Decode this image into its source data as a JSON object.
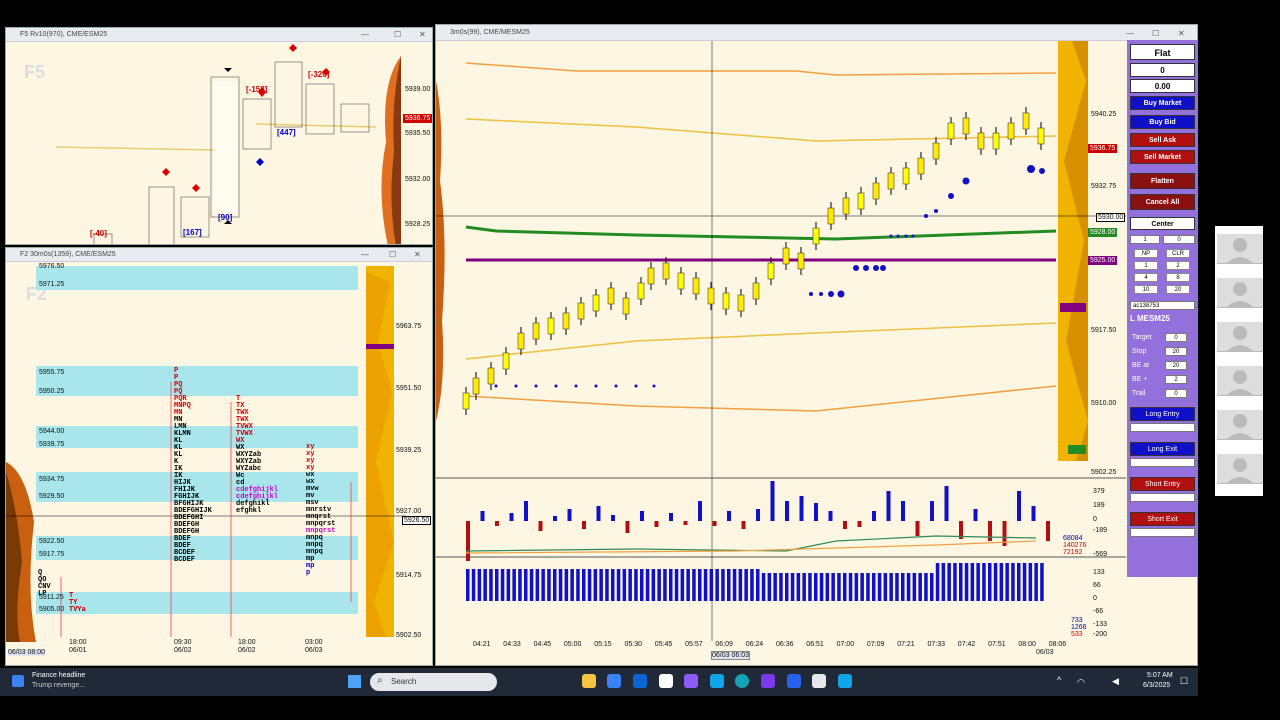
{
  "windows": {
    "top_left": {
      "title": "F5 Rv10(970), CME/ESM25",
      "watermark": "F5",
      "price_labels": [
        "5939.00",
        "5936.75",
        "5935.50",
        "5932.00",
        "5928.25"
      ],
      "delta_labels": [
        "[-40]",
        "[167]",
        "[90]",
        "[-158]",
        "[447]",
        "[-320]"
      ]
    },
    "bottom_left": {
      "title": "F2 30m0s(1359), CME/ESM25",
      "watermark": "F2",
      "left_prices": [
        "5976.50",
        "5971.25",
        "5955.75",
        "5950.25",
        "5944.00",
        "5939.75",
        "5934.75",
        "5929.50",
        "5922.50",
        "5917.75",
        "5911.25",
        "5905.00"
      ],
      "right_prices": [
        "5963.75",
        "5951.50",
        "5939.25",
        "5927.00",
        "5926.50",
        "5914.75",
        "5902.50"
      ],
      "time_labels": [
        {
          "t": "18:00",
          "d": "06/01"
        },
        {
          "t": "09:30",
          "d": "06/02"
        },
        {
          "t": "18:00",
          "d": "06/02"
        },
        {
          "t": "03:00",
          "d": "06/03"
        }
      ],
      "date_left": "06/03 08:00"
    },
    "main": {
      "title": "3m0s(99), CME/MESM25",
      "price_labels": [
        "5940.25",
        "5936.75",
        "5932.75",
        "5930.00",
        "5928.00",
        "5925.00",
        "5917.50",
        "5910.00",
        "5902.25"
      ],
      "delta_axis": [
        "379",
        "189",
        "0",
        "-189",
        "-569"
      ],
      "delta_stats": [
        "68084",
        "140276",
        "72192"
      ],
      "volume_axis": [
        "133",
        "66",
        "0",
        "-66",
        "-133",
        "-200"
      ],
      "volume_stats": [
        "733",
        "1266",
        "533"
      ],
      "time_labels": [
        "04:21",
        "04:33",
        "04:45",
        "05:00",
        "05:15",
        "05:30",
        "05:45",
        "05:57",
        "06:09",
        "06:24",
        "06:36",
        "06:51",
        "07:00",
        "07:09",
        "07:21",
        "07:33",
        "07:42",
        "07:51",
        "08:00",
        "08:06"
      ],
      "time_end_date": "06/03",
      "cursor_date": "06/03 06:03"
    }
  },
  "order_panel": {
    "position": "Flat",
    "qty": "0",
    "pnl": "0.00",
    "buy_market": "Buy Market",
    "buy_bid": "Buy Bid",
    "sell_ask": "Sell Ask",
    "sell_market": "Sell Market",
    "flatten": "Flatten",
    "cancel_all": "Cancel All",
    "center": "Center",
    "qty_value": "1",
    "qty_value2": "0",
    "quick": [
      "NP",
      "CLR",
      "1",
      "2",
      "4",
      "8",
      "10",
      "20"
    ],
    "account": "ac138753",
    "instrument": "L MESM25",
    "target_label": "Target",
    "target": "0",
    "stop_label": "Stop",
    "stop": "20",
    "be_at_label": "BE at",
    "be_at": "20",
    "be_plus_label": "BE +",
    "be_plus": "2",
    "trail_label": "Trail",
    "trail": "0",
    "long_entry": "Long Entry",
    "long_exit": "Long Exit",
    "short_entry": "Short Entry",
    "short_exit": "Short Exit"
  },
  "taskbar": {
    "news_title": "Finance headline",
    "news_sub": "Trump revenge...",
    "search": "Search",
    "time": "5:07 AM",
    "date": "6/3/2025"
  },
  "colors": {
    "buy": "#1010c8",
    "sell": "#b01010",
    "panel": "#9370db",
    "profile": "#f0b400"
  }
}
